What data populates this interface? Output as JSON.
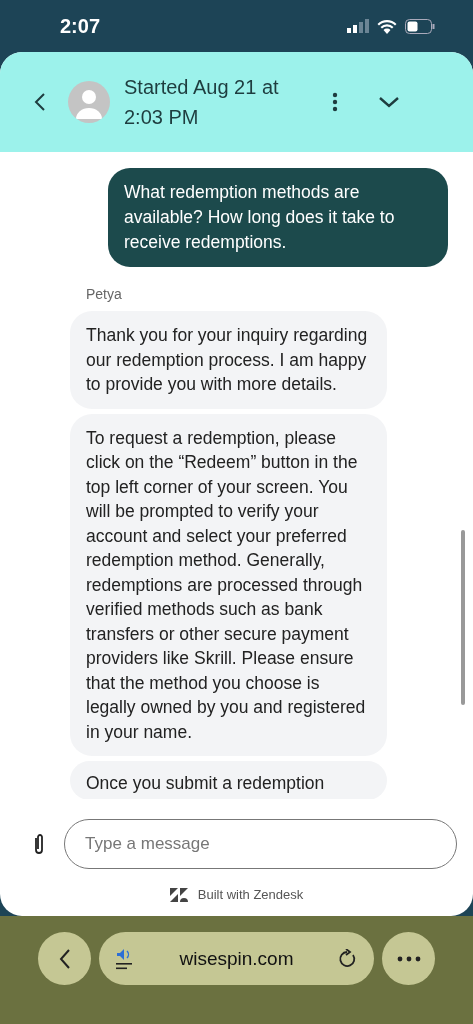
{
  "status_bar": {
    "time": "2:07"
  },
  "header": {
    "title": "Started Aug 21 at 2:03 PM"
  },
  "messages": [
    {
      "kind": "user",
      "text": "What redemption methods are available? How long does it take to receive redemptions."
    },
    {
      "kind": "sender",
      "text": "Petya"
    },
    {
      "kind": "agent",
      "text": "Thank you for your inquiry regarding our redemption process. I am happy to provide you with more details."
    },
    {
      "kind": "agent",
      "text": "To request a redemption, please click on the “Redeem” button in the top left corner of your screen. You will be prompted to verify your account and select your preferred redemption method. Generally, redemptions are processed through verified methods such as bank transfers or other secure payment providers like Skrill. Please ensure that the method you choose is legally owned by you and registered in your name."
    },
    {
      "kind": "agent",
      "text": "Once you submit a redemption"
    }
  ],
  "composer": {
    "placeholder": "Type a message"
  },
  "footer": {
    "text": "Built with Zendesk"
  },
  "browser": {
    "url": "wisespin.com"
  }
}
